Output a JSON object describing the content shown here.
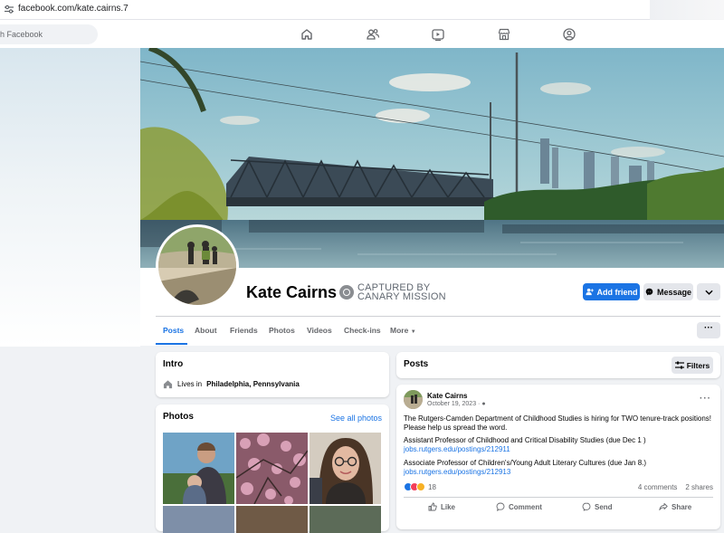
{
  "browser": {
    "url": "facebook.com/kate.cairns.7"
  },
  "nav": {
    "search_placeholder": "h Facebook"
  },
  "profile": {
    "name": "Kate Cairns",
    "badge_line1": "CAPTURED BY",
    "badge_line2": "CANARY MISSION",
    "add_friend_label": "Add friend",
    "message_label": "Message"
  },
  "tabs": [
    "Posts",
    "About",
    "Friends",
    "Photos",
    "Videos",
    "Check-ins",
    "More"
  ],
  "intro": {
    "title": "Intro",
    "lives_prefix": "Lives in",
    "city": "Philadelphia, Pennsylvania"
  },
  "photos": {
    "title": "Photos",
    "see_all": "See all photos"
  },
  "posts": {
    "title": "Posts",
    "filters_label": "Filters"
  },
  "post": {
    "author": "Kate Cairns",
    "date": "October 19, 2023 ·",
    "line1": "The Rutgers-Camden Department of Childhood Studies is hiring for TWO tenure-track positions!",
    "line2": "Please help us spread the word.",
    "line3": "Assistant Professor of Childhood and Critical Disability Studies (due Dec 1 )",
    "link1": "jobs.rutgers.edu/postings/212911",
    "line4": "Associate Professor of Children's/Young Adult Literary Cultures (due Jan 8.)",
    "link2": "jobs.rutgers.edu/postings/212913",
    "reactions": "18",
    "comments": "4 comments",
    "shares": "2 shares",
    "like": "Like",
    "comment": "Comment",
    "send": "Send",
    "share": "Share"
  },
  "colors": {
    "accent": "#1b74e4",
    "background": "#f0f2f5"
  },
  "icons": [
    "home-icon",
    "friends-icon",
    "watch-icon",
    "marketplace-icon",
    "groups-icon",
    "clock-icon",
    "house-icon",
    "messenger-icon",
    "filter-icon"
  ]
}
